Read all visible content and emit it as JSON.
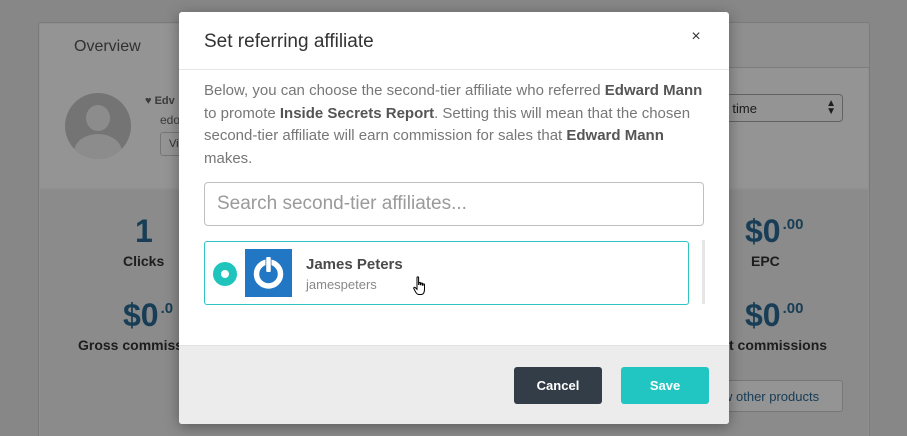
{
  "background": {
    "tab_label": "Overview",
    "profile_name_partial": "Edv",
    "profile_email_partial": "edo",
    "view_button_partial": "Vi",
    "period_select_value": "ll time",
    "stats": {
      "clicks_value": "1",
      "clicks_label": "Clicks",
      "epc_value": "$0",
      "epc_cents": ".00",
      "epc_label": "EPC",
      "gross_value": "$0",
      "gross_cents": ".0",
      "gross_label": "Gross commiss",
      "net_value": "$0",
      "net_cents": ".00",
      "net_label": "t commissions"
    },
    "other_products_button": "w other products"
  },
  "modal": {
    "title": "Set referring affiliate",
    "close_symbol": "×",
    "description": {
      "part1": "Below, you can choose the second-tier affiliate who referred ",
      "affiliate_name": "Edward Mann",
      "part2": " to promote ",
      "product_name": "Inside Secrets Report",
      "part3": ". Setting this will mean that the chosen second-tier affiliate will earn commission for sales that ",
      "affiliate_name_2": "Edward Mann",
      "part4": " makes."
    },
    "search": {
      "placeholder": "Search second-tier affiliates...",
      "value": ""
    },
    "affiliates": [
      {
        "name": "James Peters",
        "username": "jamespeters",
        "selected": true
      }
    ],
    "cancel_label": "Cancel",
    "save_label": "Save"
  },
  "colors": {
    "accent": "#21c6c2",
    "dark_button": "#333d47",
    "stat_blue": "#2a6a94",
    "avatar_blue": "#2177c3"
  },
  "icons": {
    "close": "close-icon",
    "radio": "radio-selected-icon",
    "affiliate_avatar": "power-logo-icon",
    "pointer": "hand-pointer-cursor-icon"
  }
}
